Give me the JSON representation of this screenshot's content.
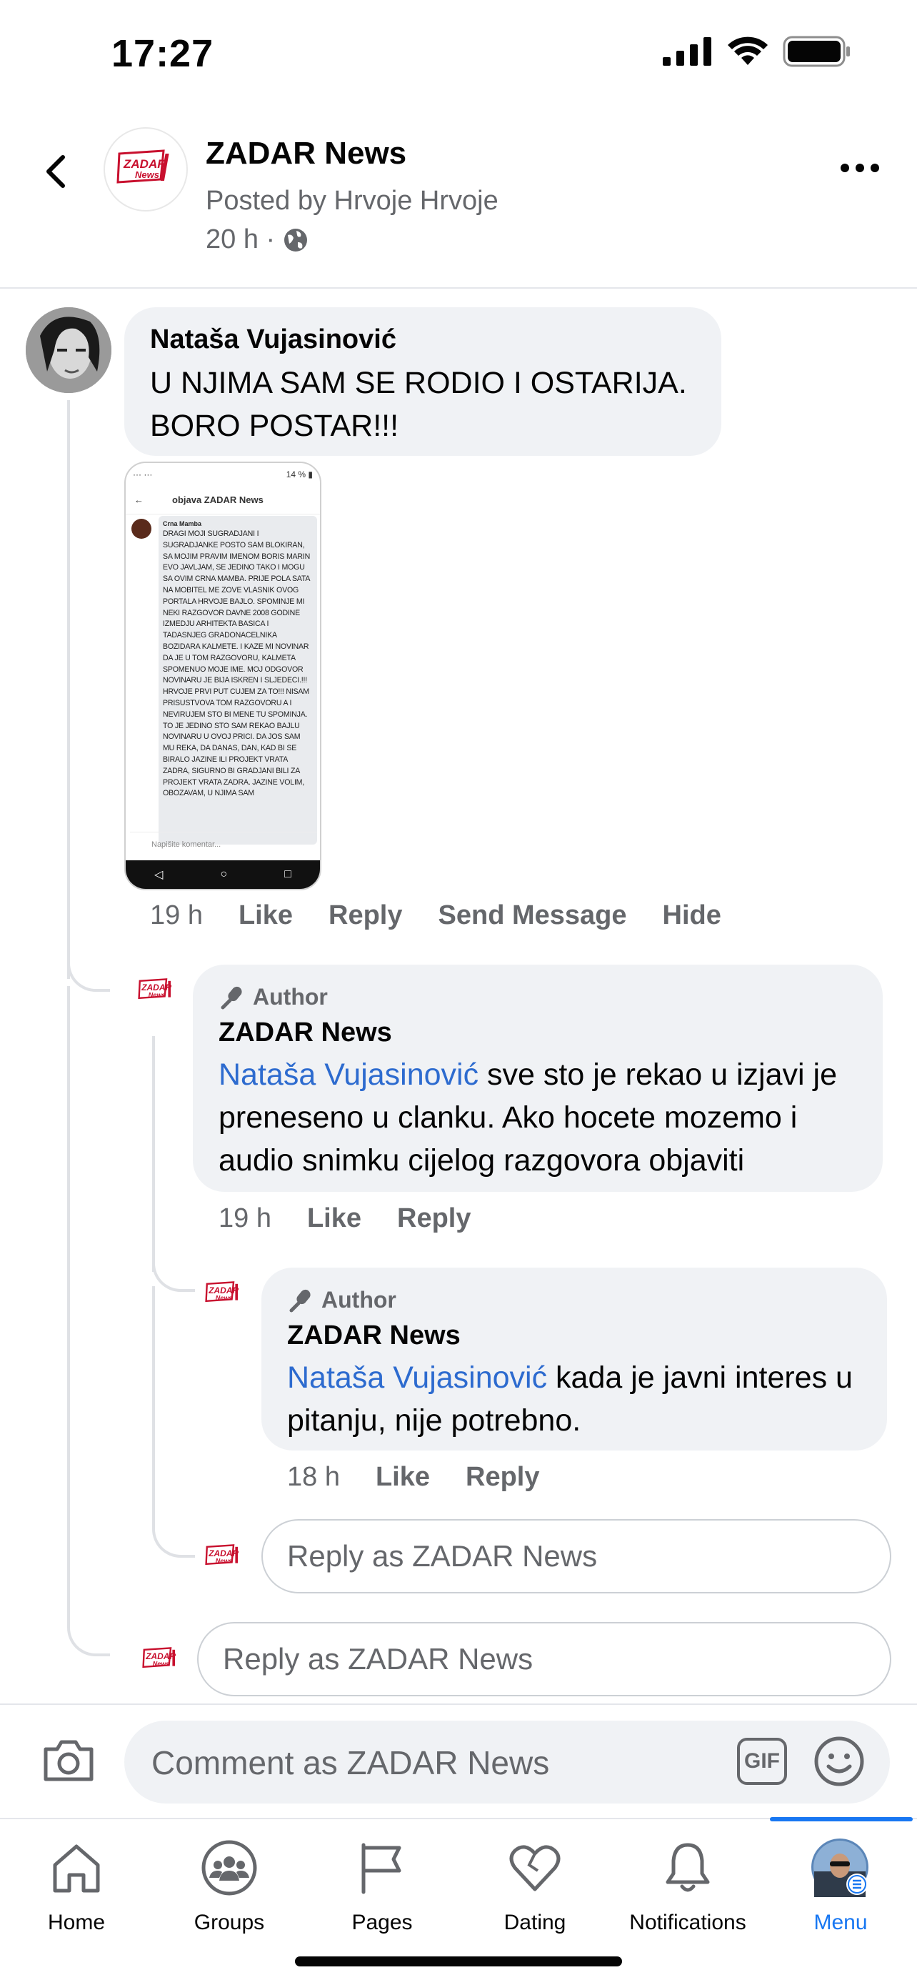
{
  "status_bar": {
    "time": "17:27"
  },
  "header": {
    "page_name": "ZADAR News",
    "posted_by": "Posted by Hrvoje Hrvoje",
    "time": "20 h ·",
    "logo_text": "ZADAR News"
  },
  "comments": [
    {
      "author": "Nataša Vujasinović",
      "text": "U NJIMA SAM SE RODIO I OSTARIJA. BORO POSTAR!!!",
      "attachment": {
        "header_title": "objava ZADAR News",
        "commenter": "Crna Mamba",
        "body": "DRAGI MOJI SUGRADJANI I SUGRADJANKE POSTO SAM BLOKIRAN, SA MOJIM PRAVIM IMENOM BORIS MARIN EVO JAVLJAM, SE JEDINO TAKO I MOGU SA OVIM CRNA MAMBA. PRIJE POLA SATA NA MOBITEL ME ZOVE VLASNIK OVOG PORTALA HRVOJE BAJLO. SPOMINJE MI NEKI RAZGOVOR DAVNE 2008 GODINE IZMEDJU ARHITEKTA BASICA I TADASNJEG GRADONACELNIKA BOZIDARA KALMETE. I KAZE MI NOVINAR DA JE U TOM RAZGOVORU, KALMETA SPOMENUO MOJE IME. MOJ ODGOVOR NOVINARU JE BIJA ISKREN I SLJEDECI.!!! HRVOJE PRVI PUT CUJEM ZA TO!!! NISAM PRISUSTVOVA TOM RAZGOVORU A I NEVIRUJEM STO BI MENE TU SPOMINJA. TO JE JEDINO STO SAM REKAO BAJLU NOVINARU U OVOJ PRICI. DA JOS SAM MU REKA, DA DANAS, DAN, KAD BI SE BIRALO JAZINE ILI PROJEKT VRATA ZADRA, SIGURNO BI GRADJANI BILI ZA PROJEKT VRATA ZADRA. JAZINE VOLIM, OBOZAVAM, U NJIMA SAM",
        "input_placeholder": "Napišite komentar..."
      },
      "time": "19 h",
      "actions": [
        "Like",
        "Reply",
        "Send Message",
        "Hide"
      ]
    },
    {
      "badge": "Author",
      "author": "ZADAR News",
      "mention": "Nataša Vujasinović",
      "text": " sve sto je rekao u izjavi je preneseno u clanku. Ako hocete mozemo i audio snimku cijelog razgovora objaviti",
      "time": "19 h",
      "actions": [
        "Like",
        "Reply"
      ]
    },
    {
      "badge": "Author",
      "author": "ZADAR News",
      "mention": "Nataša Vujasinović",
      "text": " kada je javni interes u pitanju, nije potrebno.",
      "time": "18 h",
      "actions": [
        "Like",
        "Reply"
      ]
    }
  ],
  "reply_inputs": {
    "nested_placeholder": "Reply as ZADAR News",
    "thread_placeholder": "Reply as ZADAR News"
  },
  "composer": {
    "placeholder": "Comment as ZADAR News",
    "gif_label": "GIF"
  },
  "tabbar": {
    "tabs": [
      {
        "label": "Home",
        "icon": "home-icon"
      },
      {
        "label": "Groups",
        "icon": "groups-icon"
      },
      {
        "label": "Pages",
        "icon": "flag-icon"
      },
      {
        "label": "Dating",
        "icon": "heart-icon"
      },
      {
        "label": "Notifications",
        "icon": "bell-icon"
      },
      {
        "label": "Menu",
        "icon": "profile-avatar",
        "active": true
      }
    ],
    "active_color": "#1877f2"
  },
  "colors": {
    "mention": "#2d6bcf",
    "secondary_text": "#65676b",
    "bubble": "#f0f2f5",
    "logo_red": "#c8102e"
  }
}
